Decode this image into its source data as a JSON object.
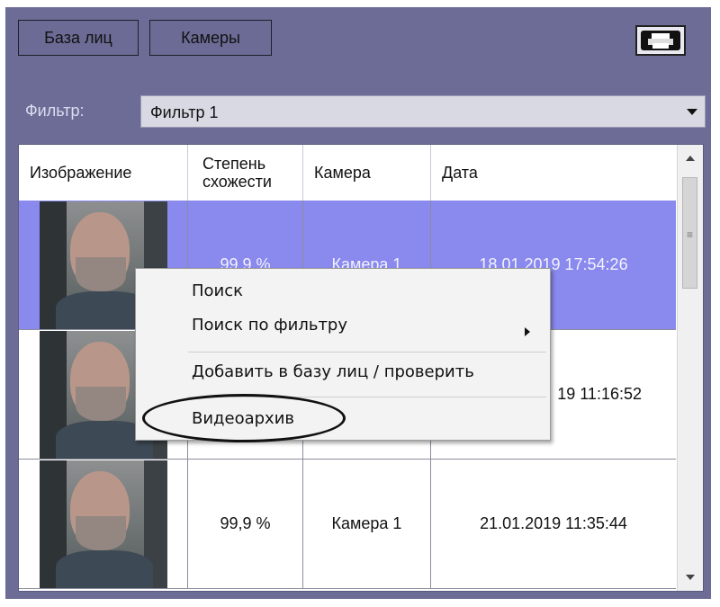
{
  "toolbar": {
    "tab_faces": "База лиц",
    "tab_cameras": "Камеры",
    "print_icon": "print-icon"
  },
  "filter": {
    "label": "Фильтр:",
    "value": "Фильтр 1"
  },
  "table": {
    "columns": {
      "image": "Изображение",
      "similarity": "Степень схожести",
      "camera": "Камера",
      "date": "Дата"
    },
    "rows": [
      {
        "similarity": "99,9 %",
        "camera": "Камера 1",
        "date": "18.01.2019 17:54:26",
        "selected": true
      },
      {
        "similarity": "",
        "camera": "",
        "date": "19 11:16:52",
        "selected": false
      },
      {
        "similarity": "99,9 %",
        "camera": "Камера 1",
        "date": "21.01.2019 11:35:44",
        "selected": false
      }
    ]
  },
  "context_menu": {
    "search": "Поиск",
    "search_by_filter": "Поиск по фильтру",
    "add_to_faces": "Добавить в базу лиц / проверить",
    "video_archive": "Видеоархив"
  },
  "colors": {
    "panel": "#6c6c97",
    "selection": "#8989ee",
    "menu": "#f3f3f3"
  }
}
